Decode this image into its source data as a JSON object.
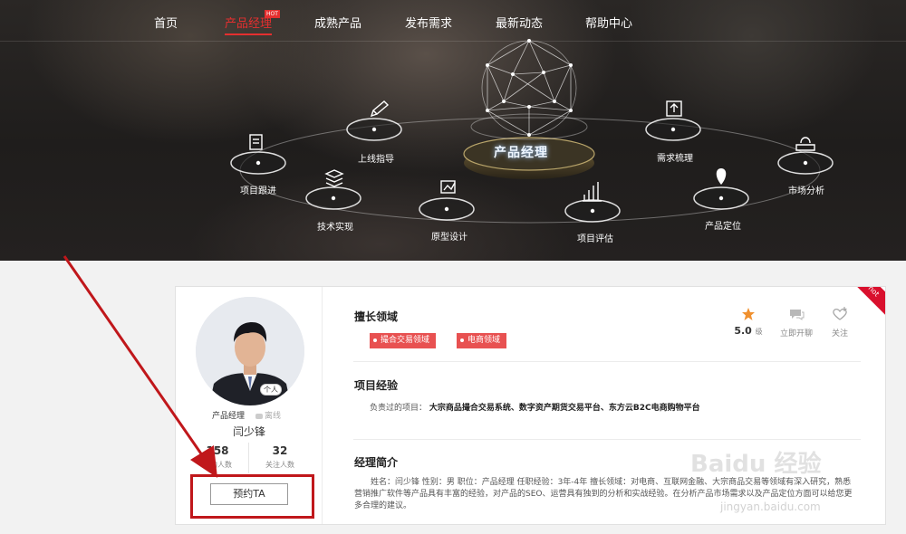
{
  "nav": {
    "items": [
      "首页",
      "产品经理",
      "成熟产品",
      "发布需求",
      "最新动态",
      "帮助中心"
    ],
    "hot_badge": "HOT"
  },
  "banner": {
    "center_label": "产品经理",
    "nodes": [
      "项目跟进",
      "上线指导",
      "技术实现",
      "原型设计",
      "项目评估",
      "产品定位",
      "需求梳理",
      "市场分析"
    ]
  },
  "profile": {
    "avatar_badge": "个人",
    "role": "产品经理",
    "status": "离线",
    "name": "闫少锋",
    "stats": [
      {
        "value": "158",
        "label": "预约人数"
      },
      {
        "value": "32",
        "label": "关注人数"
      }
    ],
    "book_button": "预约TA"
  },
  "detail": {
    "expertise_title": "擅长领域",
    "tags": [
      "撮合交易领域",
      "电商领域"
    ],
    "experience_title": "项目经验",
    "project_prefix": "负责过的项目：",
    "projects": "大宗商品撮合交易系统、数字资产期货交易平台、东方云B2C电商购物平台",
    "intro_title": "经理简介",
    "intro_text": "姓名：闫少锋 性别：男 职位：产品经理 任职经验：3年-4年 擅长领域：对电商、互联网金融、大宗商品交易等领域有深入研究，熟悉营销推广软件等产品具有丰富的经验，对产品的SEO、运营具有独到的分析和实战经验。在分析产品市场需求以及产品定位方面可以给您更多合理的建议。"
  },
  "actions": {
    "rating": "5.0",
    "rating_unit": "级",
    "chat": "立即开聊",
    "follow": "关注"
  },
  "corner_badge": "hot",
  "watermark": {
    "brand": "Baidu 经验",
    "url": "jingyan.baidu.com"
  },
  "colors": {
    "accent_red": "#e52f2f",
    "tag_red": "#e85151",
    "annotation_red": "#c0171b",
    "star_orange": "#f0902e"
  }
}
